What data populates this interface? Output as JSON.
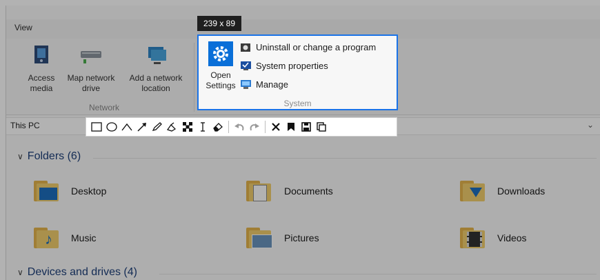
{
  "ribbon": {
    "tab_view": "View",
    "access_media": "Access media",
    "map_network": "Map network drive",
    "add_network": "Add a network location",
    "network_group": "Network",
    "open_settings": "Open Settings",
    "uninstall": "Uninstall or change a program",
    "system_properties": "System properties",
    "manage": "Manage",
    "system_group": "System"
  },
  "selection": {
    "size": "239 x 89"
  },
  "address": {
    "path": "This PC"
  },
  "content": {
    "folders_header": "Folders (6)",
    "devices_header": "Devices and drives (4)",
    "folders": [
      {
        "name": "Desktop"
      },
      {
        "name": "Documents"
      },
      {
        "name": "Downloads"
      },
      {
        "name": "Music"
      },
      {
        "name": "Pictures"
      },
      {
        "name": "Videos"
      }
    ]
  },
  "toolbar": {
    "tools": [
      "rectangle-tool",
      "ellipse-tool",
      "polyline-tool",
      "arrow-tool",
      "pencil-tool",
      "marker-tool",
      "mosaic-tool",
      "text-tool",
      "eraser-tool",
      "undo",
      "redo",
      "cancel",
      "pin",
      "save",
      "copy"
    ]
  }
}
